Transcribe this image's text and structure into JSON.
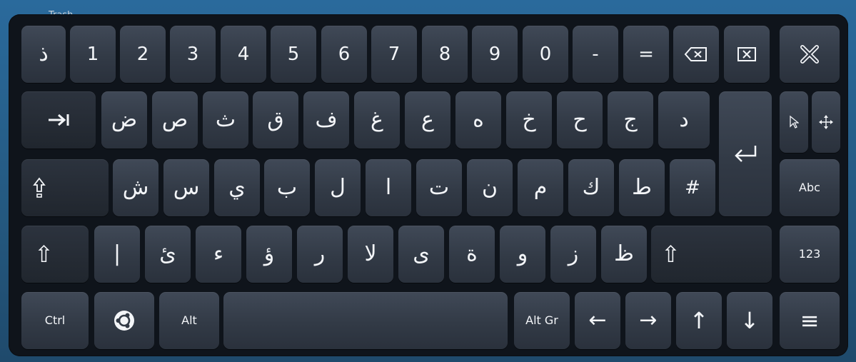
{
  "desktop": {
    "trash_label": "Trash"
  },
  "row1": [
    "ذ",
    "1",
    "2",
    "3",
    "4",
    "5",
    "6",
    "7",
    "8",
    "9",
    "0",
    "-",
    "="
  ],
  "row2": [
    "ض",
    "ص",
    "ث",
    "ق",
    "ف",
    "غ",
    "ع",
    "ه",
    "خ",
    "ح",
    "ج",
    "د"
  ],
  "row3": [
    "ش",
    "س",
    "ي",
    "ب",
    "ل",
    "ا",
    "ت",
    "ن",
    "م",
    "ك",
    "ط",
    "#"
  ],
  "row4": [
    "|",
    "ئ",
    "ء",
    "ؤ",
    "ر",
    "لا",
    "ى",
    "ة",
    "و",
    "ز",
    "ظ"
  ],
  "modifiers": {
    "ctrl": "Ctrl",
    "alt": "Alt",
    "altgr": "Alt Gr",
    "abc": "Abc",
    "num": "123"
  },
  "arrows": {
    "left": "←",
    "right": "→",
    "up": "↑",
    "down": "↓"
  },
  "glyphs": {
    "shift": "⇧",
    "menu": "≡"
  },
  "colors": {
    "key_top": "#404957",
    "key_bottom": "#2a313c",
    "board": "#0f141b",
    "text": "#f3f5f8"
  }
}
